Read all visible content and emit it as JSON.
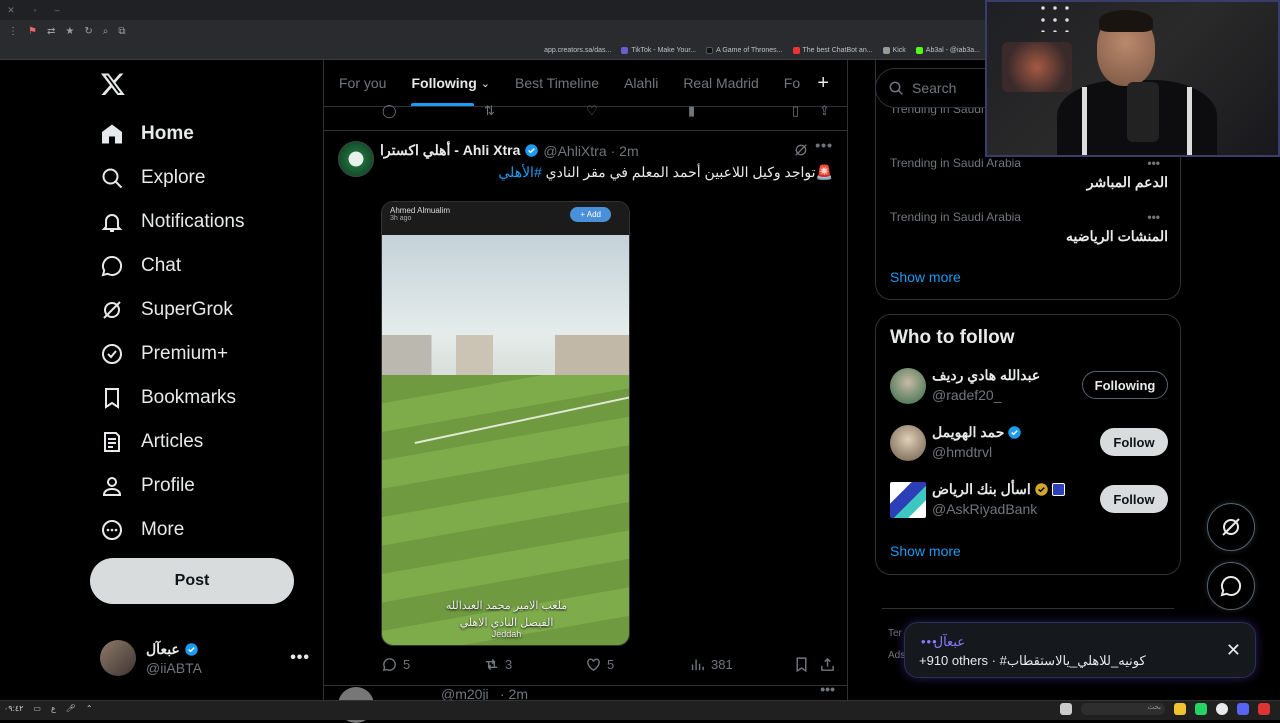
{
  "browser": {
    "bookmarks": [
      "app.creators.sa/das...",
      "TikTok - Make Your...",
      "A Game of Thrones...",
      "The best ChatBot an...",
      "Kick",
      "Ab3al - @iab3a..."
    ]
  },
  "nav": {
    "items": [
      {
        "label": "Home",
        "icon": "home-icon"
      },
      {
        "label": "Explore",
        "icon": "search-icon"
      },
      {
        "label": "Notifications",
        "icon": "bell-icon"
      },
      {
        "label": "Chat",
        "icon": "chat-bubble-icon"
      },
      {
        "label": "SuperGrok",
        "icon": "grok-icon"
      },
      {
        "label": "Premium+",
        "icon": "verified-badge-icon"
      },
      {
        "label": "Bookmarks",
        "icon": "bookmark-icon"
      },
      {
        "label": "Articles",
        "icon": "article-icon"
      },
      {
        "label": "Profile",
        "icon": "person-icon"
      },
      {
        "label": "More",
        "icon": "more-circle-icon"
      }
    ],
    "post_label": "Post",
    "account": {
      "display_name": "عبعآل",
      "handle": "@iiABTA"
    }
  },
  "timeline": {
    "tabs": [
      "For you",
      "Following",
      "Best Timeline",
      "Alahli",
      "Real Madrid",
      "Fo"
    ],
    "active_tab": "Following",
    "tweet": {
      "display_name": "أهلي اكسترا - Ahli Xtra",
      "handle": "@AhliXtra",
      "time": "· 2m",
      "text_prefix": "🚨تواجد وكيل اللاعبين أحمد المعلم في مقر النادي ",
      "hashtag": "#الأهلي",
      "media": {
        "story_name": "Ahmed Almualim",
        "story_time": "3h ago",
        "add_label": "+ Add",
        "caption_line1": "ملعب الامير محمد العبدالله",
        "caption_line2": "الفيصل   النادي الاهلي",
        "caption_line3": "Jeddah"
      },
      "replies": "5",
      "reposts": "3",
      "likes": "5",
      "views": "381"
    },
    "next_tweet": {
      "handle": "@m20ji",
      "time": "· 2m"
    }
  },
  "sidebar": {
    "search_placeholder": "Search",
    "trends": [
      {
        "category": "Trending in Saudi Arabia",
        "name": "الدعم المباشر"
      },
      {
        "category": "Trending in Saudi Arabia",
        "name": "المنشات الرياضيه"
      }
    ],
    "partial_trend_category": "Trending in Saudi Arabia",
    "show_more": "Show more",
    "who_to_follow": {
      "title": "Who to follow",
      "users": [
        {
          "name": "عبدالله هادي رديف",
          "handle": "@radef20_",
          "button": "Following"
        },
        {
          "name": "حمد الهويمل",
          "handle": "@hmdtrvl",
          "button": "Follow"
        },
        {
          "name": "اسأل بنك الرياض",
          "handle": "@AskRiyadBank",
          "button": "Follow"
        }
      ],
      "show_more": "Show more"
    },
    "footer": [
      "Ter",
      "Ads"
    ]
  },
  "notification": {
    "name": "عبعآل",
    "dots": "•••",
    "text": "+910 others · #كونيه_للاهلي_يالاستقطاب"
  },
  "taskbar": {
    "search_placeholder": "بحث",
    "clock": "٠٩:٤٢"
  },
  "colors": {
    "accent": "#1d9bf0",
    "background": "#000000",
    "border": "#2f3336",
    "muted_text": "#71767b",
    "verified_gold": "#d4a72c"
  }
}
